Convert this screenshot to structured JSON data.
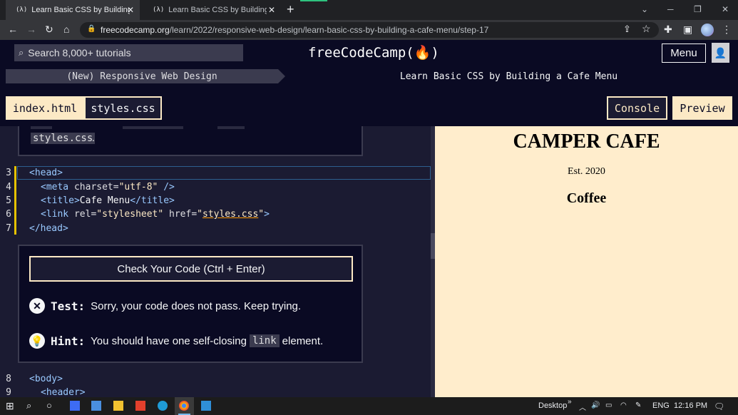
{
  "browser": {
    "tabs": [
      {
        "favicon": "(λ)",
        "title": "Learn Basic CSS by Building a Cafe Menu"
      },
      {
        "favicon": "(λ)",
        "title": "Learn Basic CSS by Building a Cafe Menu"
      }
    ],
    "new_tab": "+",
    "url_domain": "freecodecamp.org",
    "url_path": "/learn/2022/responsive-web-design/learn-basic-css-by-building-a-cafe-menu/step-17"
  },
  "nav": {
    "search_placeholder": "Search 8,000+ tutorials",
    "logo": "freeCodeCamp(🔥)",
    "menu_label": "Menu"
  },
  "breadcrumb": {
    "course": "(New) Responsive Web Design",
    "project": "Learn Basic CSS by Building a Cafe Menu"
  },
  "editor_tabs": {
    "index": "index.html",
    "styles": "styles.css",
    "console": "Console",
    "preview": "Preview"
  },
  "description": {
    "code": "styles.css",
    "tail": "."
  },
  "code_lines": {
    "n3": "3",
    "n4": "4",
    "n5": "5",
    "n6": "6",
    "n7": "7",
    "n8": "8",
    "n9": "9",
    "l3": "<head>",
    "l4_open": "<meta",
    "l4_attr": " charset=",
    "l4_val": "\"utf-8\"",
    "l4_close": " />",
    "l5_open": "<title>",
    "l5_text": "Cafe Menu",
    "l5_close": "</title>",
    "l6_open": "<link",
    "l6_attr1": " rel=",
    "l6_val1": "\"stylesheet\"",
    "l6_attr2": " href=",
    "l6_q1": "\"",
    "l6_val2": "styles.css",
    "l6_q2": "\"",
    "l6_close": ">",
    "l7": "</head>",
    "l8": "<body>",
    "l9": "<header>"
  },
  "feedback": {
    "check_button": "Check Your Code (Ctrl + Enter)",
    "test_label": "Test:",
    "test_text": "Sorry, your code does not pass. Keep trying.",
    "hint_label": "Hint:",
    "hint_pre": "You should have one self-closing",
    "hint_code": "link",
    "hint_post": "element."
  },
  "preview": {
    "title": "CAMPER CAFE",
    "est": "Est. 2020",
    "section": "Coffee"
  },
  "taskbar": {
    "desktop": "Desktop",
    "chevrons": "»",
    "lang": "ENG",
    "time": "12:16 PM"
  }
}
